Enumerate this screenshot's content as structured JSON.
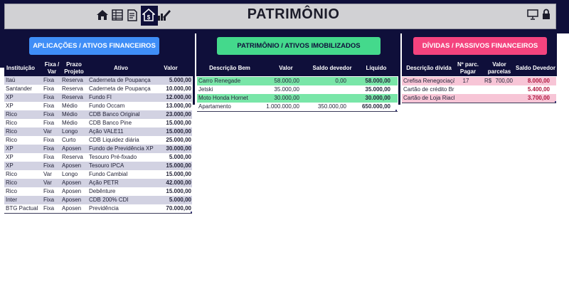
{
  "header": {
    "title": "PATRIMÔNIO",
    "nav_icons": [
      "home-icon",
      "spreadsheet-icon",
      "document-edit-icon",
      "house-dollar-icon",
      "chart-pencil-icon"
    ],
    "right_icons": [
      "presentation-icon",
      "lock-icon"
    ]
  },
  "colors": {
    "dark": "#0f0f3a",
    "applications_button": "#3f8ef7",
    "patrimony_button": "#44d98c",
    "debts_button": "#f4437e",
    "row_band": "#d2d2e2",
    "green_band": "#79e6a8",
    "pink_band": "#f7c5d6"
  },
  "applications": {
    "button": "APLICAÇÕES / ATIVOS FINANCEIROS",
    "headers": {
      "institution": "Instituição",
      "type": "Fixa / Var",
      "term": "Prazo Projeto",
      "asset": "Ativo",
      "value": "Valor"
    },
    "rows": [
      {
        "institution": "Itaú",
        "type": "Fixa",
        "term": "Reserva",
        "asset": "Caderneta de Poupança",
        "value": "5.000,00"
      },
      {
        "institution": "Santander",
        "type": "Fixa",
        "term": "Reserva",
        "asset": "Caderneta de Poupança",
        "value": "10.000,00"
      },
      {
        "institution": "XP",
        "type": "Fixa",
        "term": "Reserva",
        "asset": "Fundo FI",
        "value": "12.000,00"
      },
      {
        "institution": "XP",
        "type": "Fixa",
        "term": "Médio",
        "asset": "Fundo Occam",
        "value": "13.000,00"
      },
      {
        "institution": "Rico",
        "type": "Fixa",
        "term": "Médio",
        "asset": "CDB Banco Original",
        "value": "23.000,00"
      },
      {
        "institution": "Rico",
        "type": "Fixa",
        "term": "Médio",
        "asset": "CDB Banco Pine",
        "value": "15.000,00"
      },
      {
        "institution": "Rico",
        "type": "Var",
        "term": "Longo",
        "asset": "Ação VALE11",
        "value": "15.000,00"
      },
      {
        "institution": "Rico",
        "type": "Fixa",
        "term": "Curto",
        "asset": "CDB Liquidez diária",
        "value": "25.000,00"
      },
      {
        "institution": "XP",
        "type": "Fixa",
        "term": "Aposen",
        "asset": "Fundo de Previdência XP",
        "value": "30.000,00"
      },
      {
        "institution": "XP",
        "type": "Fixa",
        "term": "Reserva",
        "asset": "Tesouro Pré-fixado",
        "value": "5.000,00"
      },
      {
        "institution": "XP",
        "type": "Fixa",
        "term": "Aposen",
        "asset": "Tesouro IPCA",
        "value": "15.000,00"
      },
      {
        "institution": "Rico",
        "type": "Var",
        "term": "Longo",
        "asset": "Fundo Cambial",
        "value": "15.000,00"
      },
      {
        "institution": "Rico",
        "type": "Var",
        "term": "Aposen",
        "asset": "Ação PETR",
        "value": "42.000,00"
      },
      {
        "institution": "Rico",
        "type": "Fixa",
        "term": "Aposen",
        "asset": "Debênture",
        "value": "15.000,00"
      },
      {
        "institution": "Inter",
        "type": "Fixa",
        "term": "Aposen",
        "asset": "CDB 200% CDI",
        "value": "5.000,00"
      },
      {
        "institution": "BTG Pactual",
        "type": "Fixa",
        "term": "Aposen",
        "asset": "Previdência",
        "value": "70.000,00"
      }
    ]
  },
  "patrimony": {
    "button": "PATRIMÔNIO / ATIVOS IMOBILIZADOS",
    "headers": {
      "description": "Descrição Bem",
      "value": "Valor",
      "balance": "Saldo devedor",
      "net": "Líquido"
    },
    "rows": [
      {
        "description": "Carro Renegade",
        "value": "58.000,00",
        "balance": "0,00",
        "net": "58.000,00"
      },
      {
        "description": "Jetski",
        "value": "35.000,00",
        "balance": "",
        "net": "35.000,00"
      },
      {
        "description": "Moto Honda Hornet",
        "value": "30.000,00",
        "balance": "",
        "net": "30.000,00"
      },
      {
        "description": "Apartamento",
        "value": "1.000.000,00",
        "balance": "350.000,00",
        "net": "650.000,00"
      }
    ]
  },
  "debts": {
    "button": "DÍVIDAS / PASSIVOS FINANCEIROS",
    "headers": {
      "description": "Descrição dívida",
      "installments": "Nº parc. Pagar",
      "installment_value": "Valor parcelas",
      "balance": "Saldo Devedor"
    },
    "rows": [
      {
        "description": "Crefisa Renegociação",
        "installments": "17",
        "currency": "R$",
        "installment_value": "700,00",
        "balance": "8.000,00"
      },
      {
        "description": "Cartão de crédito Bradesco",
        "installments": "",
        "currency": "",
        "installment_value": "",
        "balance": "5.400,00"
      },
      {
        "description": "Cartão de Loja Riachuelo",
        "installments": "",
        "currency": "",
        "installment_value": "",
        "balance": "3.700,00"
      }
    ]
  }
}
